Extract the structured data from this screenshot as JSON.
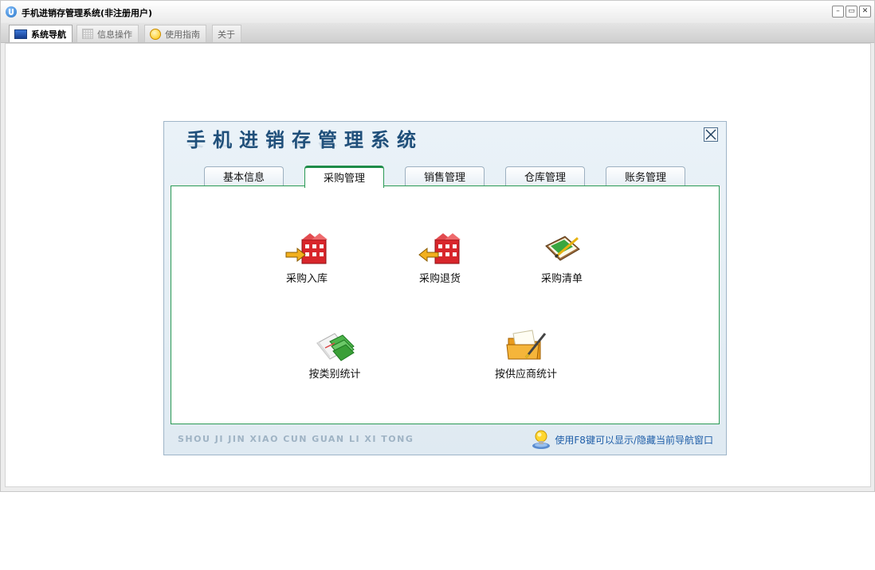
{
  "window": {
    "title": "手机进销存管理系统(非注册用户)",
    "buttons": [
      "–",
      "▭",
      "✕"
    ]
  },
  "tabs": [
    {
      "label": "系统导航",
      "icon": "monitor-icon",
      "active": true
    },
    {
      "label": "信息操作",
      "icon": "grid-icon",
      "active": false
    },
    {
      "label": "使用指南",
      "icon": "help-icon",
      "active": false
    },
    {
      "label": "关于",
      "icon": "",
      "active": false
    }
  ],
  "nav": {
    "title": "手机进销存管理系统",
    "tabs": [
      "基本信息",
      "采购管理",
      "销售管理",
      "仓库管理",
      "账务管理"
    ],
    "active_tab": "采购管理",
    "items": [
      {
        "label": "采购入库",
        "icon": "stock-in-icon"
      },
      {
        "label": "采购退货",
        "icon": "stock-return-icon"
      },
      {
        "label": "采购清单",
        "icon": "purchase-list-icon"
      },
      {
        "label": "按类别统计",
        "icon": "category-stats-icon"
      },
      {
        "label": "按供应商统计",
        "icon": "supplier-stats-icon"
      }
    ],
    "footer_text": "SHOU JI JIN XIAO CUN GUAN LI XI TONG",
    "hint_text": "使用F8键可以显示/隐藏当前导航窗口"
  },
  "colors": {
    "accent_green": "#2b9a55",
    "title_blue": "#1f4f7a",
    "hint_blue": "#1f5ea8"
  }
}
